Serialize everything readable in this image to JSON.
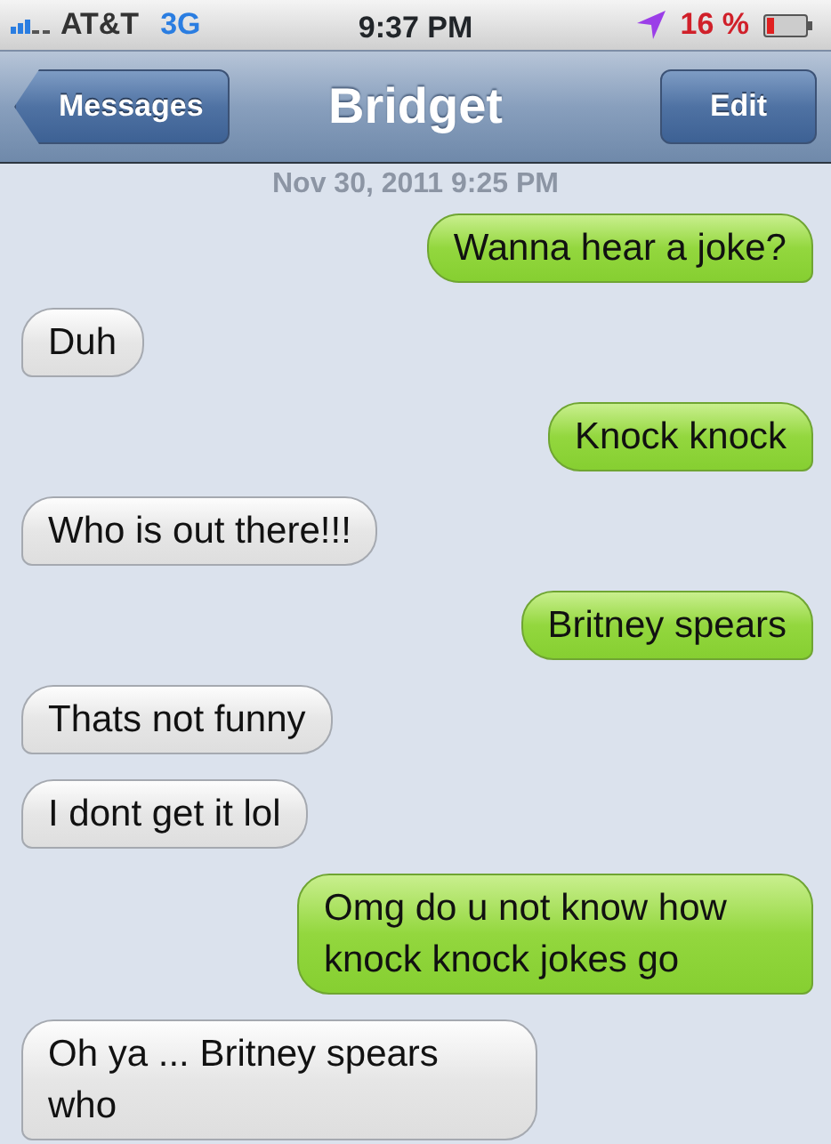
{
  "status_bar": {
    "carrier": "AT&T",
    "network": "3G",
    "time": "9:37 PM",
    "battery": "16 %"
  },
  "nav_bar": {
    "back_button": "Messages",
    "title": "Bridget",
    "edit_button": "Edit"
  },
  "timestamp": "Nov 30, 2011 9:25 PM",
  "messages": [
    {
      "kind": "sent",
      "text": "Wanna hear a joke?"
    },
    {
      "kind": "received",
      "text": "Duh"
    },
    {
      "kind": "sent",
      "text": "Knock knock"
    },
    {
      "kind": "received",
      "text": "Who is out there!!!"
    },
    {
      "kind": "sent",
      "text": "Britney spears"
    },
    {
      "kind": "received",
      "text": "Thats not funny"
    },
    {
      "kind": "received",
      "text": "I dont get it lol"
    },
    {
      "kind": "sent",
      "text": "Omg do u not know how knock knock jokes go"
    },
    {
      "kind": "received",
      "text": "Oh ya ... Britney spears who"
    }
  ]
}
